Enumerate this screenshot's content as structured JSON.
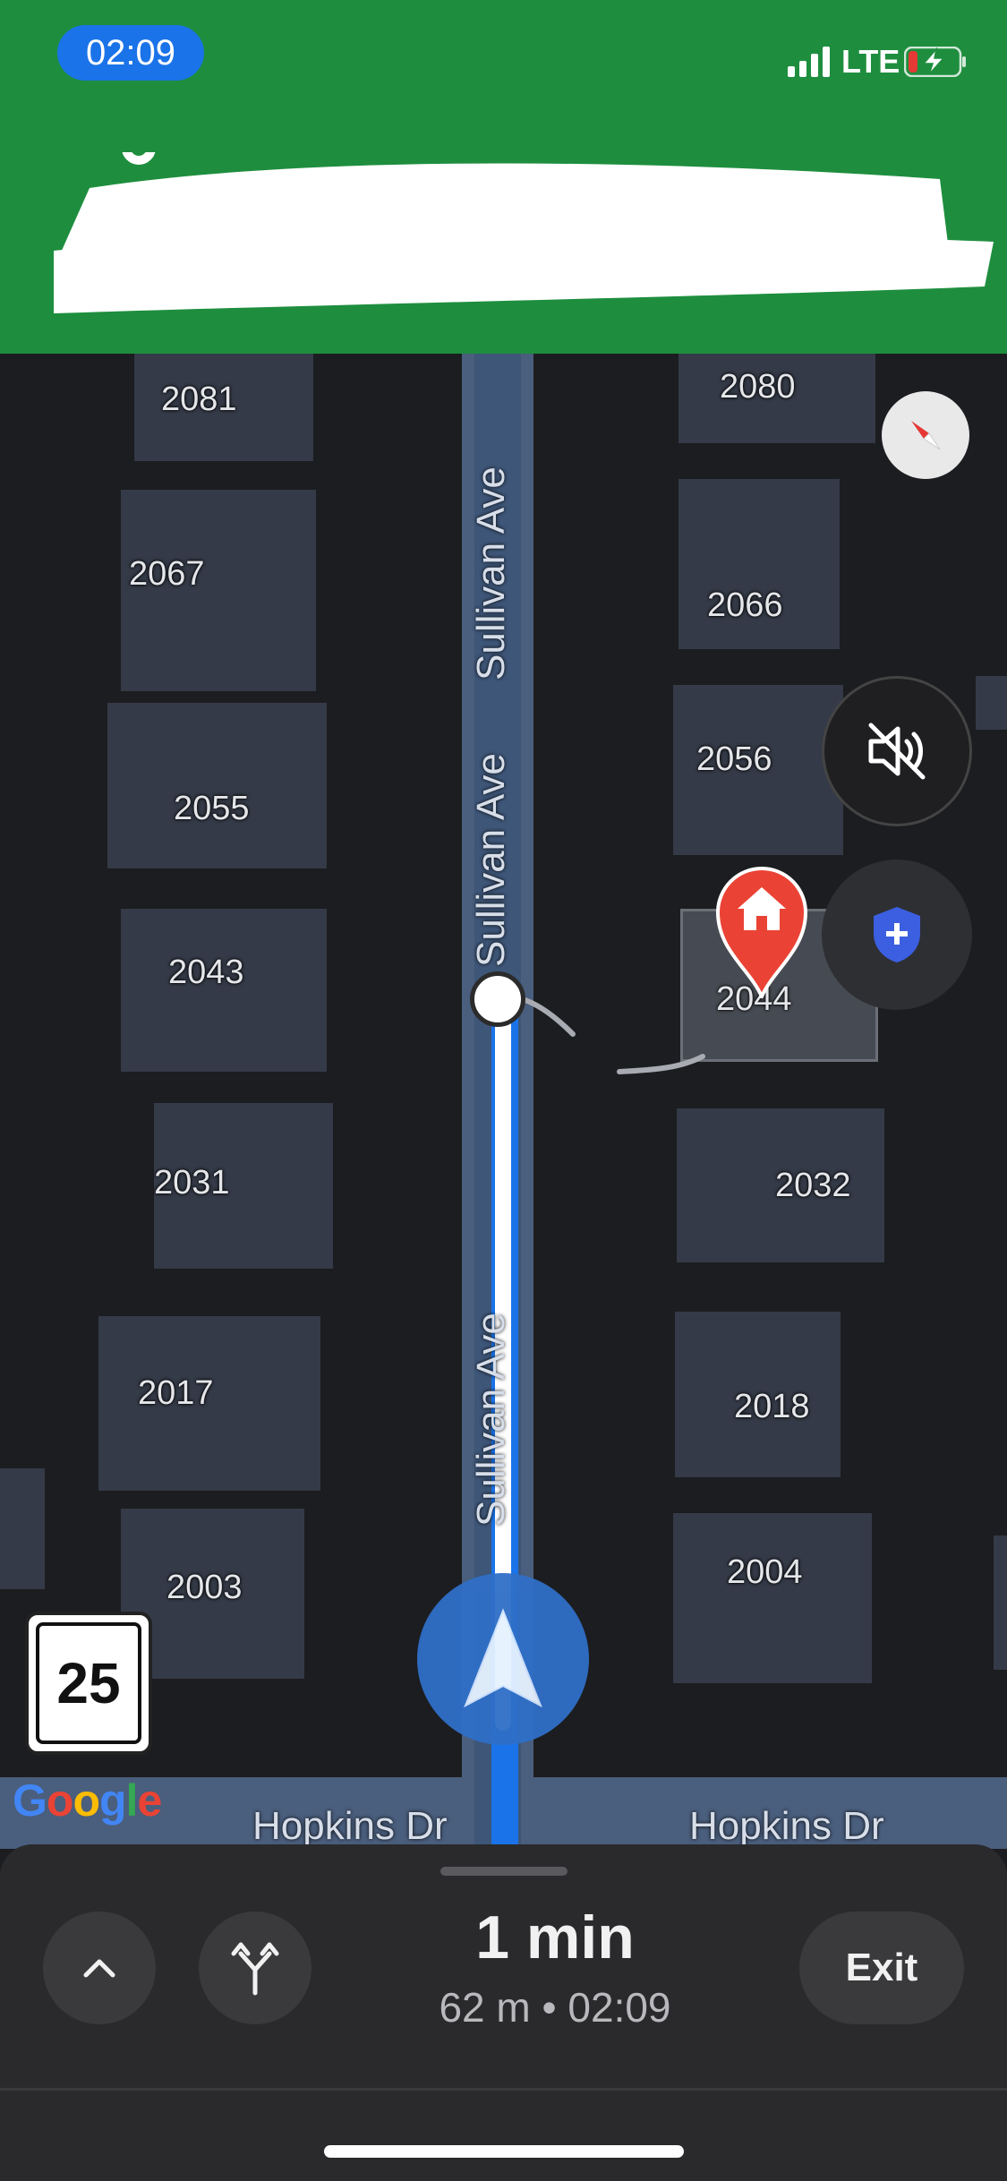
{
  "status_bar": {
    "time": "02:09",
    "network": "LTE"
  },
  "map": {
    "street_name": "Sullivan Ave",
    "cross_street": "Hopkins Dr",
    "house_numbers_left": [
      "2081",
      "2067",
      "2055",
      "2043",
      "2031",
      "2017",
      "2003"
    ],
    "house_numbers_right": [
      "2080",
      "2066",
      "2056",
      "2044",
      "2032",
      "2018",
      "2004"
    ],
    "speed_limit": "25",
    "logo": "Google"
  },
  "trip": {
    "eta_time": "1 min",
    "distance": "62 m",
    "separator": "•",
    "arrival": "02:09",
    "exit_label": "Exit"
  },
  "colors": {
    "banner_green": "#1e8e3e",
    "route_blue": "#1a73e8",
    "destination_red": "#ea4335",
    "sheet_bg": "#2a2a2c"
  },
  "icons": {
    "compass": "compass-icon",
    "mute": "volume-off-icon",
    "safety": "shield-plus-icon",
    "chevron": "chevron-up-icon",
    "alternate_routes": "fork-arrows-icon",
    "destination": "home-pin-icon",
    "navigation": "navigation-arrow-icon"
  }
}
